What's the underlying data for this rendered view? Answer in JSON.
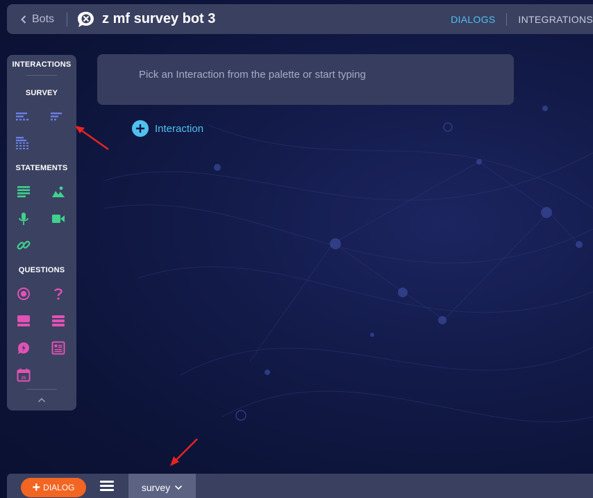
{
  "header": {
    "back_label": "Bots",
    "bot_title": "z mf survey bot 3",
    "tabs": [
      {
        "label": "DIALOGS",
        "active": true
      },
      {
        "label": "INTEGRATIONS",
        "active": false
      }
    ]
  },
  "palette": {
    "title": "INTERACTIONS",
    "sections": {
      "survey": "SURVEY",
      "statements": "STATEMENTS",
      "questions": "QUESTIONS"
    },
    "colors": {
      "survey": "#6b7fe6",
      "statements": "#3fd18e",
      "questions": "#e052b4"
    },
    "icons": {
      "survey": [
        "survey-grid-icon",
        "survey-short-icon",
        "survey-matrix-icon"
      ],
      "statements": [
        "text-icon",
        "image-icon",
        "microphone-icon",
        "video-icon",
        "link-icon"
      ],
      "questions": [
        "radio-icon",
        "question-mark-icon",
        "single-line-icon",
        "multi-line-icon",
        "quick-reply-icon",
        "form-icon",
        "calendar-icon"
      ]
    },
    "calendar_day": "25"
  },
  "main": {
    "prompt_placeholder": "Pick an Interaction from the palette or start typing",
    "add_interaction_label": "Interaction"
  },
  "footer": {
    "dialog_button_label": "DIALOG",
    "active_dialog_tab": "survey"
  },
  "theme": {
    "accent": "#4fc1ef",
    "dialog_button": "#f26522",
    "annotation_arrow": "#e52421"
  }
}
